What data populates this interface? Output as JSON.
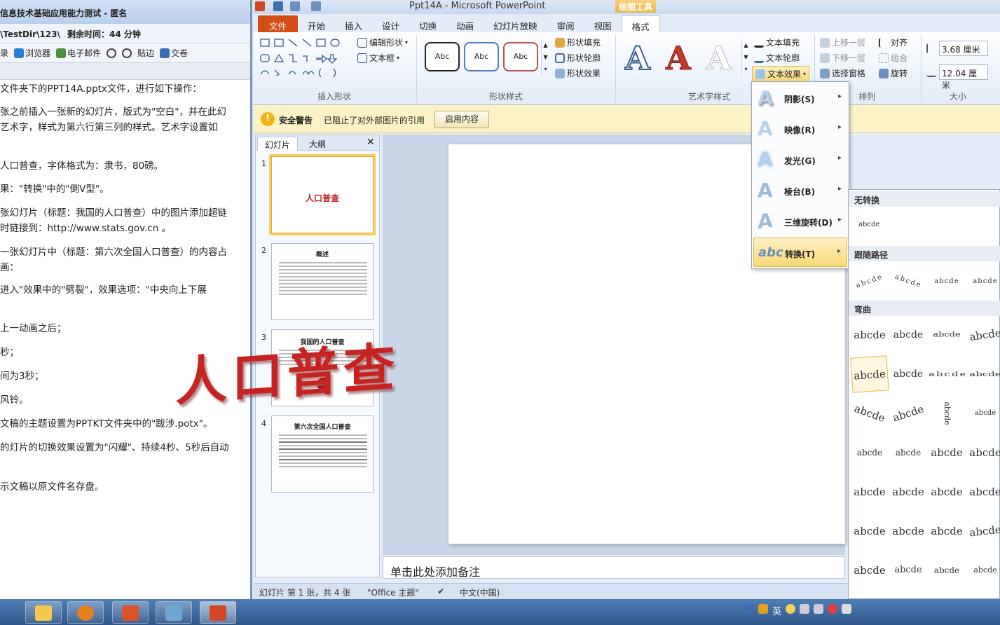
{
  "exam": {
    "title": "信息技术基础应用能力测试 - 匿名",
    "path": "\\TestDir\\123\\",
    "remaining": "剩余时间：44 分钟",
    "toolbar": [
      "录",
      "浏览器",
      "电子邮件",
      "贴边",
      "交卷"
    ],
    "lines": [
      "文件夹下的PPT14A.pptx文件，进行如下操作：",
      "张之前插入一张新的幻灯片，版式为\"空白\"，并在此幻",
      "艺术字，样式为第六行第三列的样式。艺术字设置如",
      "人口普查，字体格式为：隶书，80磅。",
      "果：\"转换\"中的\"倒V型\"。",
      "张幻灯片（标题：我国的人口普查）中的图片添加超链",
      "时链接到：http://www.stats.gov.cn 。",
      "一张幻灯片中（标题：第六次全国人口普查）的内容占",
      "画：",
      "进入\"效果中的\"劈裂\"，效果选项：\"中央向上下展",
      "上一动画之后；",
      "秒；",
      "间为3秒；",
      "风铃。",
      "文稿的主题设置为PPTKT文件夹中的\"跋涉.potx\"。",
      "的灯片的切换效果设置为\"闪耀\"、持续4秒、5秒后自动",
      "示文稿以原文件名存盘。"
    ]
  },
  "ppt": {
    "title": "Ppt14A - Microsoft PowerPoint",
    "context_tab": "绘图工具",
    "tabs": [
      "文件",
      "开始",
      "插入",
      "设计",
      "切换",
      "动画",
      "幻灯片放映",
      "审阅",
      "视图",
      "格式"
    ],
    "ribbon": {
      "insert_shapes": {
        "label": "插入形状",
        "edit_shape": "编辑形状",
        "text_box": "文本框"
      },
      "shape_styles": {
        "label": "形状样式",
        "sample": "Abc",
        "fill": "形状填充",
        "outline": "形状轮廓",
        "effects": "形状效果"
      },
      "wordart": {
        "label": "艺术字样式",
        "sample": "A",
        "text_fill": "文本填充",
        "text_outline": "文本轮廓",
        "text_effects": "文本效果"
      },
      "arrange": {
        "label": "排列",
        "bring_forward": "上移一层",
        "send_backward": "下移一层",
        "selection_pane": "选择窗格",
        "align": "对齐",
        "group": "组合",
        "rotate": "旋转"
      },
      "size": {
        "label": "大小",
        "height": "3.68 厘米",
        "width": "12.04 厘米"
      }
    },
    "security": {
      "title": "安全警告",
      "message": "已阻止了对外部图片的引用",
      "button": "启用内容"
    },
    "thumbs_tabs": [
      "幻灯片",
      "大纲"
    ],
    "slides": [
      {
        "num": "1",
        "title": "人口普查"
      },
      {
        "num": "2",
        "title": "概述"
      },
      {
        "num": "3",
        "title": "我国的人口普查"
      },
      {
        "num": "4",
        "title": "第六次全国人口普查"
      }
    ],
    "wordart_text": "人口普查",
    "notes_placeholder": "单击此处添加备注",
    "status": {
      "slide": "幻灯片 第 1 张，共 4 张",
      "theme": "\"Office 主题\"",
      "lang": "中文(中国)"
    }
  },
  "text_effects_menu": [
    {
      "label": "阴影(S)"
    },
    {
      "label": "映像(R)"
    },
    {
      "label": "发光(G)"
    },
    {
      "label": "棱台(B)"
    },
    {
      "label": "三维旋转(D)"
    },
    {
      "label": "转换(T)"
    }
  ],
  "transform_gallery": {
    "no_transform": "无转换",
    "no_transform_sample": "abcde",
    "follow_path": "跟随路径",
    "warp": "弯曲",
    "sample": "abcde"
  },
  "taskbar": {
    "tray_text": "英"
  }
}
